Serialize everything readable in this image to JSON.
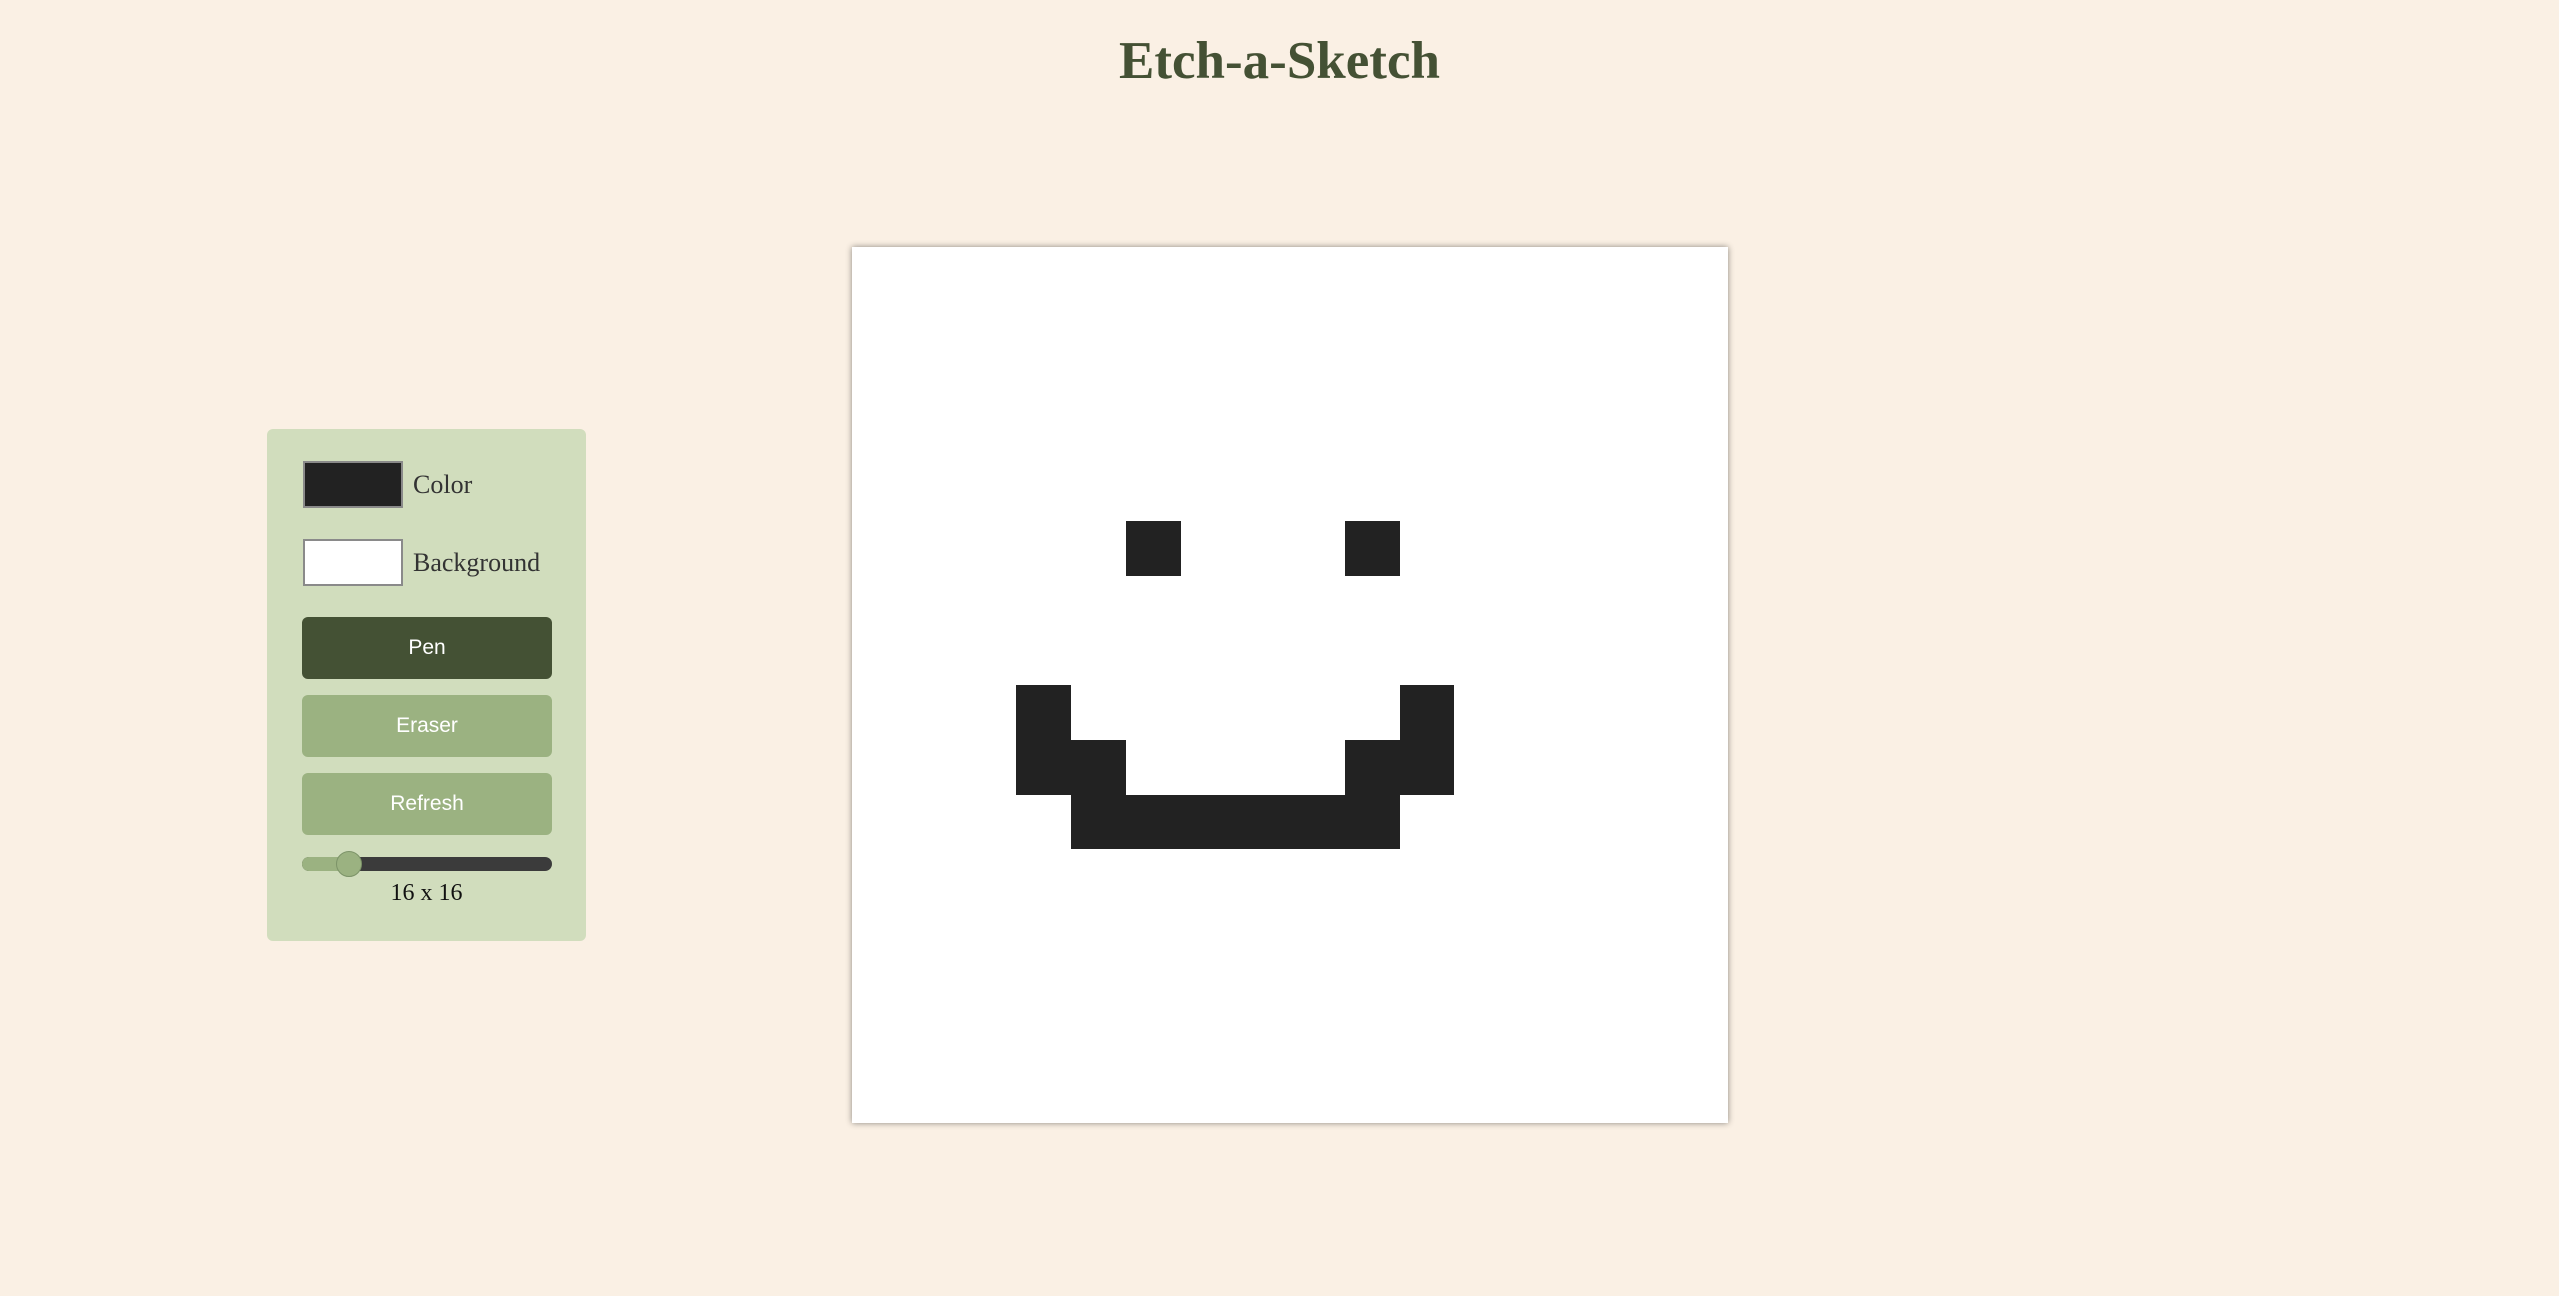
{
  "title": "Etch-a-Sketch",
  "controls": {
    "color_label": "Color",
    "background_label": "Background",
    "pen_color": "#222222",
    "background_color": "#ffffff",
    "pen_button": "Pen",
    "eraser_button": "Eraser",
    "refresh_button": "Refresh",
    "grid_size_text": "16 x 16",
    "grid_size": 16,
    "slider_min": 1,
    "slider_max": 100,
    "active_mode": "Pen",
    "active_button_color": "#445134",
    "inactive_button_color": "#9bb281"
  },
  "grid": {
    "size": 16,
    "filled_cells": [
      [
        5,
        5
      ],
      [
        5,
        9
      ],
      [
        8,
        3
      ],
      [
        8,
        10
      ],
      [
        9,
        3
      ],
      [
        9,
        4
      ],
      [
        9,
        9
      ],
      [
        9,
        10
      ],
      [
        10,
        4
      ],
      [
        10,
        5
      ],
      [
        10,
        6
      ],
      [
        10,
        7
      ],
      [
        10,
        8
      ],
      [
        10,
        9
      ]
    ]
  }
}
